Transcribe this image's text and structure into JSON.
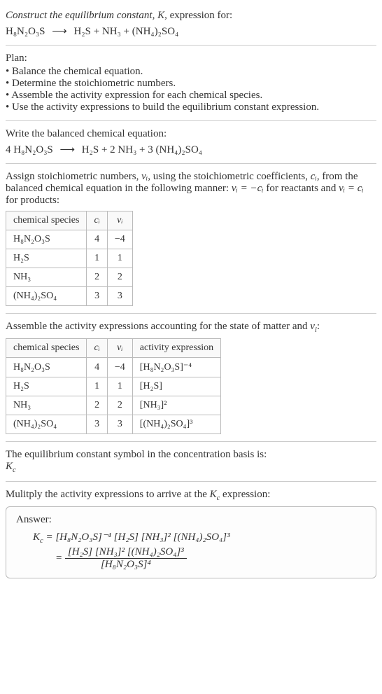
{
  "prompt": {
    "line1": "Construct the equilibrium constant, K, expression for:",
    "reactant": "H₈N₂O₃S",
    "arrow": "⟶",
    "products": "H₂S + NH₃ + (NH₄)₂SO₄"
  },
  "plan": {
    "title": "Plan:",
    "items": [
      "Balance the chemical equation.",
      "Determine the stoichiometric numbers.",
      "Assemble the activity expression for each chemical species.",
      "Use the activity expressions to build the equilibrium constant expression."
    ]
  },
  "balanced": {
    "title": "Write the balanced chemical equation:",
    "lhs": "4 H₈N₂O₃S",
    "arrow": "⟶",
    "rhs": "H₂S + 2 NH₃ + 3 (NH₄)₂SO₄"
  },
  "stoich_assign": {
    "text_a": "Assign stoichiometric numbers, ",
    "nu_i": "νᵢ",
    "text_b": ", using the stoichiometric coefficients, ",
    "c_i": "cᵢ",
    "text_c": ", from the balanced chemical equation in the following manner: ",
    "rule1": "νᵢ = −cᵢ",
    "text_d": " for reactants and ",
    "rule2": "νᵢ = cᵢ",
    "text_e": " for products:"
  },
  "table1": {
    "headers": [
      "chemical species",
      "cᵢ",
      "νᵢ"
    ],
    "rows": [
      [
        "H₈N₂O₃S",
        "4",
        "−4"
      ],
      [
        "H₂S",
        "1",
        "1"
      ],
      [
        "NH₃",
        "2",
        "2"
      ],
      [
        "(NH₄)₂SO₄",
        "3",
        "3"
      ]
    ]
  },
  "assemble_text": "Assemble the activity expressions accounting for the state of matter and νᵢ:",
  "table2": {
    "headers": [
      "chemical species",
      "cᵢ",
      "νᵢ",
      "activity expression"
    ],
    "rows": [
      [
        "H₈N₂O₃S",
        "4",
        "−4",
        "[H₈N₂O₃S]⁻⁴"
      ],
      [
        "H₂S",
        "1",
        "1",
        "[H₂S]"
      ],
      [
        "NH₃",
        "2",
        "2",
        "[NH₃]²"
      ],
      [
        "(NH₄)₂SO₄",
        "3",
        "3",
        "[(NH₄)₂SO₄]³"
      ]
    ]
  },
  "eq_const_symbol": {
    "text": "The equilibrium constant symbol in the concentration basis is:",
    "symbol": "K_c"
  },
  "multiply_text": "Mulitply the activity expressions to arrive at the K_c expression:",
  "answer": {
    "label": "Answer:",
    "line1_lhs": "K_c = ",
    "line1_rhs": "[H₈N₂O₃S]⁻⁴ [H₂S] [NH₃]² [(NH₄)₂SO₄]³",
    "line2_eq": " = ",
    "frac_num": "[H₂S] [NH₃]² [(NH₄)₂SO₄]³",
    "frac_den": "[H₈N₂O₃S]⁴"
  }
}
